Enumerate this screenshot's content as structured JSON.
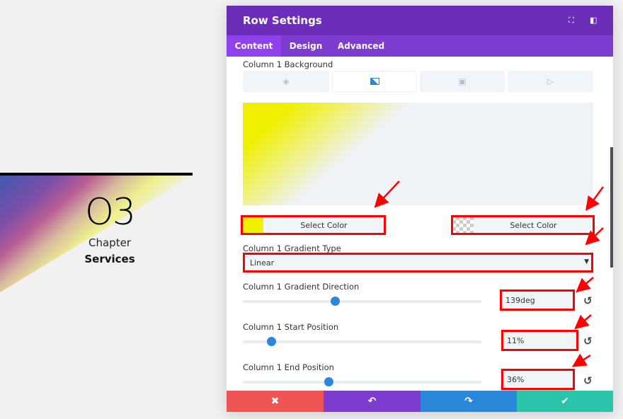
{
  "page": {
    "number": "O3",
    "chapter": "Chapter",
    "title": "Services"
  },
  "panel": {
    "title": "Row Settings",
    "tabs": [
      {
        "label": "Content",
        "active": true
      },
      {
        "label": "Design"
      },
      {
        "label": "Advanced"
      }
    ],
    "background_label": "Column 1 Background",
    "background_tabs": [
      "color-icon",
      "gradient-icon",
      "image-icon",
      "video-icon"
    ],
    "gradient": {
      "start_color": "#f0f000",
      "end_color": "transparent",
      "start_button": "Select Color",
      "end_button": "Select Color"
    },
    "gradient_type": {
      "label": "Column 1 Gradient Type",
      "value": "Linear"
    },
    "direction": {
      "label": "Column 1 Gradient Direction",
      "value": "139deg",
      "level": 139
    },
    "start_position": {
      "label": "Column 1 Start Position",
      "value": "11%",
      "level": 11
    },
    "end_position": {
      "label": "Column 1 End Position",
      "value": "36%",
      "level": 36
    },
    "footer": {
      "cancel": "✖",
      "undo": "↶",
      "redo": "↷",
      "save": "✔"
    }
  },
  "colors": {
    "header": "#6c2eb9",
    "tabs": "#7d3bcf",
    "accent": "#2b87da",
    "cancel": "#ef5555",
    "undo": "#7e3bd0",
    "redo": "#2b87da",
    "save": "#29c4a9"
  }
}
